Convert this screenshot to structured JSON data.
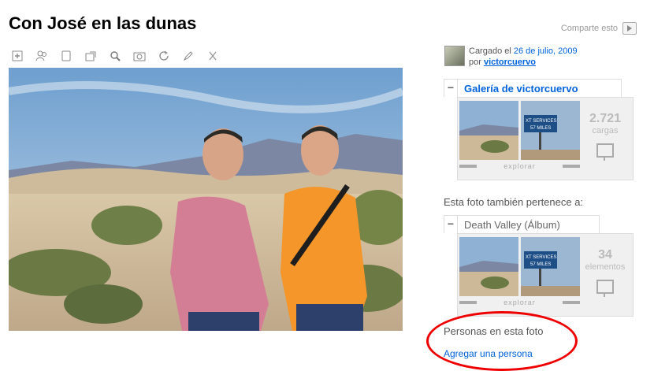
{
  "title": "Con José en las dunas",
  "share_label": "Comparte esto",
  "toolbar": {
    "icons": [
      "add-note-icon",
      "people-icon",
      "frame-icon",
      "send-icon",
      "zoom-icon",
      "photo-icon",
      "rotate-icon",
      "edit-icon",
      "delete-icon"
    ]
  },
  "uploader": {
    "prefix": "Cargado el",
    "date": "26 de julio, 2009",
    "by": "por",
    "user": "victorcuervo"
  },
  "gallery": {
    "title": "Galería de victorcuervo",
    "count": "2.721",
    "unit": "cargas",
    "explore": "explorar",
    "sign_line1": "XT SERVICES",
    "sign_line2": "57 MILES"
  },
  "also_belongs": "Esta foto también pertenece a:",
  "album": {
    "title": "Death Valley (Álbum)",
    "count": "34",
    "unit": "elementos",
    "explore": "explorar",
    "sign_line1": "XT SERVICES",
    "sign_line2": "57 MILES"
  },
  "people": {
    "heading": "Personas en esta foto",
    "add_link": "Agregar una persona"
  },
  "colors": {
    "link": "#0063dc",
    "highlight_circle": "#e00000"
  }
}
